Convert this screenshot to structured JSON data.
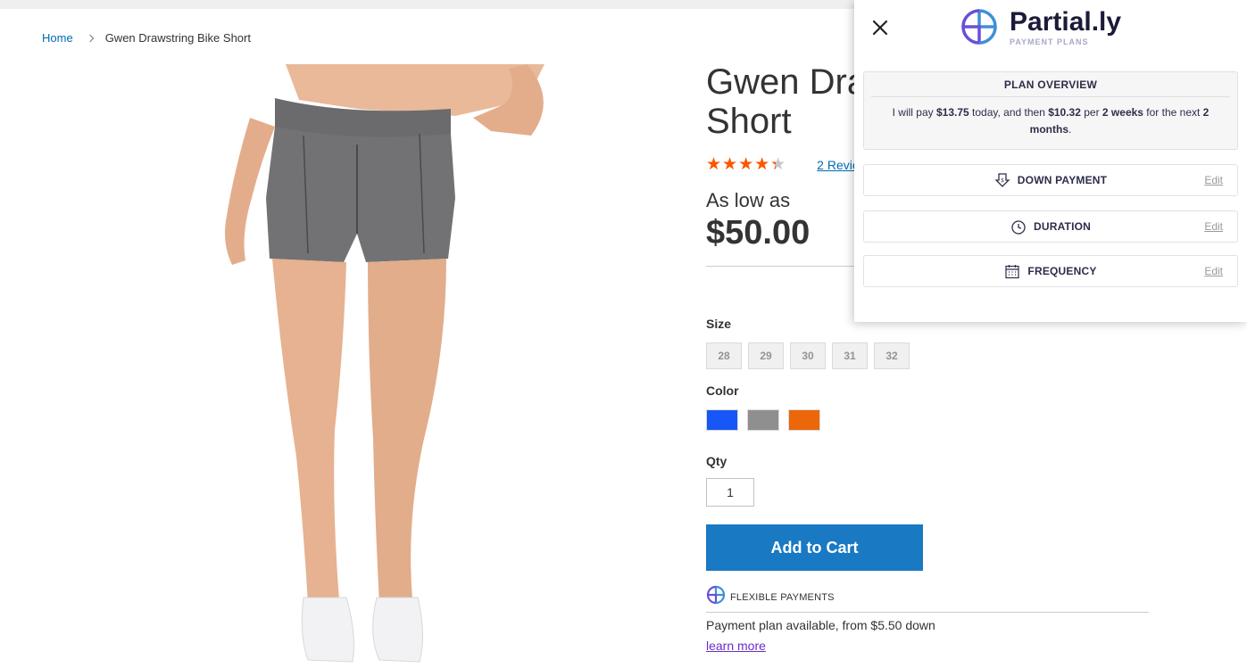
{
  "breadcrumb": {
    "home": "Home",
    "current": "Gwen Drawstring Bike Short"
  },
  "product": {
    "title_line1": "Gwen Dra",
    "title_line2": "Short",
    "rating_percent": 87,
    "reviews_link": "2  Revie",
    "price_label": "As low as",
    "price": "$50.00"
  },
  "options": {
    "size_label": "Size",
    "sizes": [
      "28",
      "29",
      "30",
      "31",
      "32"
    ],
    "color_label": "Color",
    "colors": [
      "#1857f7",
      "#8f8f8f",
      "#eb6709"
    ],
    "qty_label": "Qty",
    "qty_value": "1"
  },
  "actions": {
    "add_to_cart": "Add to Cart"
  },
  "financing": {
    "badge": "FLEXIBLE PAYMENTS",
    "plan_text": "Payment plan available, from $5.50 down",
    "learn_more": "learn more"
  },
  "partially": {
    "logo_name": "Partial.ly",
    "logo_sub": "PAYMENT PLANS",
    "overview_title": "PLAN OVERVIEW",
    "overview": {
      "t1": "I will pay ",
      "today_amount": "$13.75",
      "t2": " today, and then ",
      "installment_amount": "$10.32",
      "t3": " per ",
      "frequency": "2 weeks",
      "t4": " for the next ",
      "duration_num": "2",
      "duration_unit": "months",
      "t5": "."
    },
    "rows": [
      {
        "label": "DOWN PAYMENT",
        "edit": "Edit",
        "icon": "down-payment-icon"
      },
      {
        "label": "DURATION",
        "edit": "Edit",
        "icon": "clock-icon"
      },
      {
        "label": "FREQUENCY",
        "edit": "Edit",
        "icon": "calendar-icon"
      }
    ]
  },
  "colors": {
    "link": "#006bb4",
    "cta": "#1979c3",
    "star": "#ff5501",
    "brand_blue": "#3f8fd9",
    "brand_purple": "#6a4fd8"
  }
}
